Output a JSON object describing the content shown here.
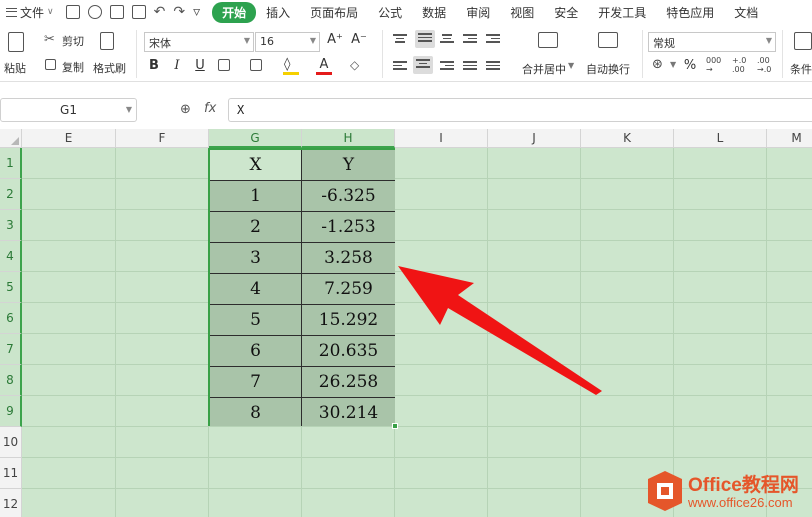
{
  "menubar": {
    "file_label": "文件",
    "tabs": [
      {
        "label": "开始",
        "active": true
      },
      {
        "label": "插入"
      },
      {
        "label": "页面布局"
      },
      {
        "label": "公式"
      },
      {
        "label": "数据"
      },
      {
        "label": "审阅"
      },
      {
        "label": "视图"
      },
      {
        "label": "安全"
      },
      {
        "label": "开发工具"
      },
      {
        "label": "特色应用"
      },
      {
        "label": "文档"
      }
    ]
  },
  "ribbon": {
    "paste_label": "粘贴",
    "cut_label": "剪切",
    "copy_label": "复制",
    "format_painter_label": "格式刷",
    "font_name": "宋体",
    "font_size": "16",
    "bold": "B",
    "italic": "I",
    "underline": "U",
    "font_color_glyph": "A",
    "increase_font": "A⁺",
    "decrease_font": "A⁻",
    "merge_center_label": "合并居中",
    "wrap_text_label": "自动换行",
    "number_format": "常规",
    "percent_glyph": "%",
    "conditional_label": "条件"
  },
  "formula_bar": {
    "cell_ref": "G1",
    "fx_label": "fx",
    "formula": "X"
  },
  "sheet": {
    "columns": [
      "E",
      "F",
      "G",
      "H",
      "I",
      "J",
      "K",
      "L",
      "M"
    ],
    "selected_columns": [
      "G",
      "H"
    ],
    "rows": [
      "1",
      "2",
      "3",
      "4",
      "5",
      "6",
      "7",
      "8",
      "9",
      "10",
      "11",
      "12"
    ],
    "selected_rows": [
      "1",
      "2",
      "3",
      "4",
      "5",
      "6",
      "7",
      "8",
      "9"
    ],
    "table": {
      "headers": [
        "X",
        "Y"
      ],
      "rows": [
        [
          "1",
          "-6.325"
        ],
        [
          "2",
          "-1.253"
        ],
        [
          "3",
          "3.258"
        ],
        [
          "4",
          "7.259"
        ],
        [
          "5",
          "15.292"
        ],
        [
          "6",
          "20.635"
        ],
        [
          "7",
          "26.258"
        ],
        [
          "8",
          "30.214"
        ]
      ]
    }
  },
  "watermark": {
    "brand": "Office教程网",
    "url": "www.office26.com"
  },
  "colors": {
    "accent": "#2da24f",
    "sheet_bg": "#cde6cd",
    "selection_fill": "#a9c4a9",
    "selection_border": "#38a046",
    "arrow": "#f01414",
    "watermark": "#e5562a"
  },
  "icons": [
    "hamburger-icon",
    "save-icon",
    "print-icon",
    "undo-icon",
    "redo-icon",
    "paste-icon",
    "scissors-icon",
    "copy-icon",
    "format-painter-icon",
    "zoom-icon",
    "red-arrow-icon",
    "office-logo-icon"
  ]
}
